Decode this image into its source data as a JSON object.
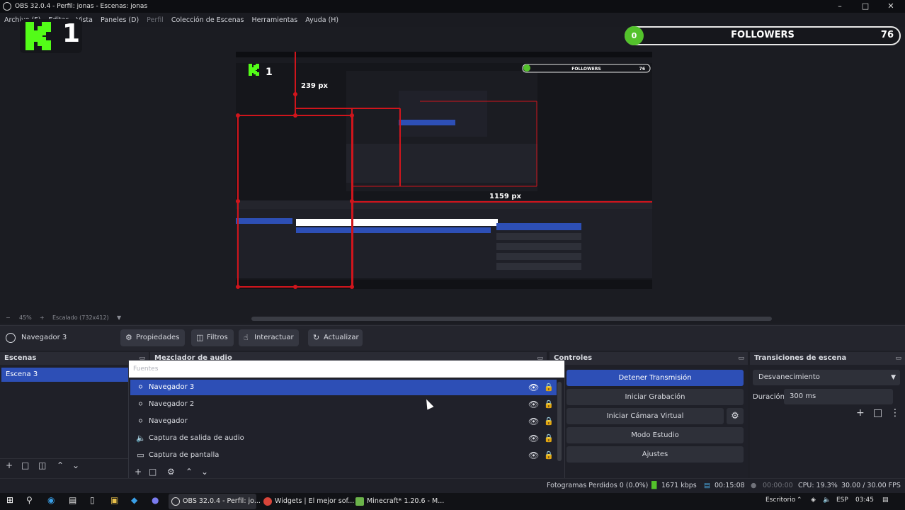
{
  "window": {
    "title": "OBS 32.0.4 - Perfil: jonas - Escenas: jonas"
  },
  "menu": [
    "Archivo (F)",
    "Editar",
    "Vista",
    "Paneles (D)",
    "Perfil",
    "Colección de Escenas",
    "Herramientas",
    "Ayuda (H)"
  ],
  "overlay": {
    "kick_count": "1",
    "followers_label": "FOLLOWERS",
    "followers_left": "0",
    "followers_count": "76"
  },
  "nested_preview": {
    "label_239": "239 px",
    "label_1159": "1159 px",
    "followers_label": "FOLLOWERS",
    "followers_count": "76",
    "kick_count": "1"
  },
  "zoom": {
    "value": "45%",
    "scale_label": "Escalado (732x412)"
  },
  "source_toolbar": {
    "name": "Navegador 3",
    "props": "Propiedades",
    "filters": "Filtros",
    "interact": "Interactuar",
    "refresh": "Actualizar"
  },
  "scenes": {
    "header": "Escenas",
    "items": [
      "Escena 3"
    ]
  },
  "mixer": {
    "header": "Mezclador de audio"
  },
  "sources": {
    "header": "Fuentes",
    "items": [
      {
        "name": "Navegador 3",
        "icon": "globe-icon"
      },
      {
        "name": "Navegador 2",
        "icon": "globe-icon"
      },
      {
        "name": "Navegador",
        "icon": "globe-icon"
      },
      {
        "name": "Captura de salida de audio",
        "icon": "speaker-icon"
      },
      {
        "name": "Captura de pantalla",
        "icon": "monitor-icon"
      }
    ]
  },
  "controls": {
    "header": "Controles",
    "stop_stream": "Detener Transmisión",
    "start_rec": "Iniciar Grabación",
    "start_vcam": "Iniciar Cámara Virtual",
    "studio": "Modo Estudio",
    "settings": "Ajustes"
  },
  "transitions": {
    "header": "Transiciones de escena",
    "selected": "Desvanecimiento",
    "duration_label": "Duración",
    "duration": "300 ms"
  },
  "status": {
    "dropped": "Fotogramas Perdidos 0 (0.0%)",
    "bitrate": "1671 kbps",
    "stream_time": "00:15:08",
    "rec_time": "00:00:00",
    "cpu": "CPU: 19.3%",
    "fps": "30.00 / 30.00 FPS"
  },
  "taskbar": {
    "apps": [
      "OBS 32.0.4 - Perfil: jo...",
      "Widgets | El mejor sof...",
      "Minecraft* 1.20.6 - M..."
    ],
    "desk": "Escritorio",
    "lang": "ESP",
    "time": "03:45"
  }
}
